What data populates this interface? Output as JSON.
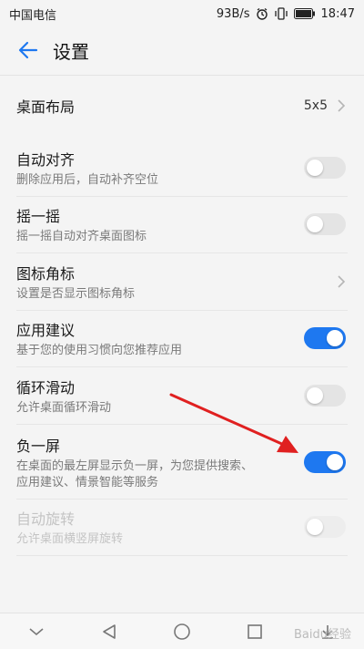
{
  "status_bar": {
    "carrier": "中国电信",
    "network_speed": "93B/s",
    "time": "18:47"
  },
  "header": {
    "title": "设置"
  },
  "settings": [
    {
      "title": "桌面布局",
      "value": "5x5",
      "control": "chevron"
    },
    {
      "title": "自动对齐",
      "subtitle": "删除应用后，自动补齐空位",
      "control": "toggle",
      "state": "off"
    },
    {
      "title": "摇一摇",
      "subtitle": "摇一摇自动对齐桌面图标",
      "control": "toggle",
      "state": "off"
    },
    {
      "title": "图标角标",
      "subtitle": "设置是否显示图标角标",
      "control": "chevron"
    },
    {
      "title": "应用建议",
      "subtitle": "基于您的使用习惯向您推荐应用",
      "control": "toggle",
      "state": "on"
    },
    {
      "title": "循环滑动",
      "subtitle": "允许桌面循环滑动",
      "control": "toggle",
      "state": "off"
    },
    {
      "title": "负一屏",
      "subtitle_line1": "在桌面的最左屏显示负一屏，为您提供搜索、",
      "subtitle_line2": "应用建议、情景智能等服务",
      "control": "toggle",
      "state": "on"
    },
    {
      "title": "自动旋转",
      "subtitle": "允许桌面横竖屏旋转",
      "control": "toggle",
      "state": "disabled"
    }
  ],
  "colors": {
    "accent": "#1e78f0",
    "annotation_arrow": "#e02020"
  },
  "icons": [
    "back-arrow-icon",
    "chevron-right-icon",
    "alarm-icon",
    "vibrate-icon",
    "battery-icon",
    "nav-down-icon",
    "nav-back-icon",
    "nav-home-icon",
    "nav-recents-icon",
    "nav-download-icon"
  ],
  "watermark": "Baidu经验"
}
